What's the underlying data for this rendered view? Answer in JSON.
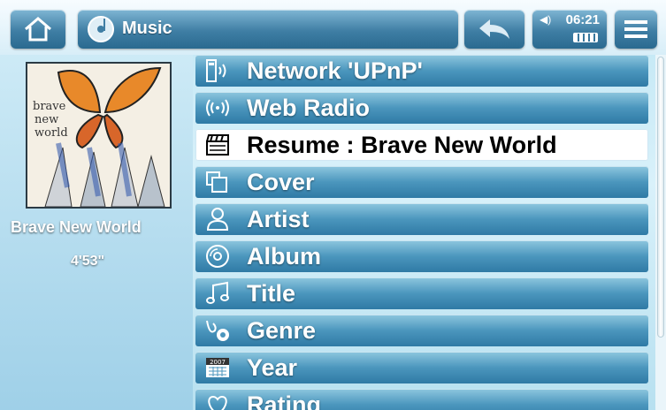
{
  "header": {
    "title": "Music",
    "time": "06:21",
    "icons": [
      "home-icon",
      "music-disc-icon",
      "back-arrow-icon",
      "volume-icon",
      "battery-icon",
      "menu-icon"
    ]
  },
  "now_playing": {
    "track": "Brave New World",
    "duration": "4'53\"",
    "cover_text": [
      "brave",
      "new",
      "world"
    ]
  },
  "menu_items": [
    {
      "label": "Network 'UPnP'",
      "icon": "network-device-icon"
    },
    {
      "label": "Web Radio",
      "icon": "radio-waves-icon"
    },
    {
      "label": "Resume : Brave New World",
      "icon": "clapperboard-icon",
      "selected": true
    },
    {
      "label": "Cover",
      "icon": "covers-icon"
    },
    {
      "label": "Artist",
      "icon": "person-icon"
    },
    {
      "label": "Album",
      "icon": "disc-icon"
    },
    {
      "label": "Title",
      "icon": "music-note-icon"
    },
    {
      "label": "Genre",
      "icon": "genre-icon"
    },
    {
      "label": "Year",
      "icon": "calendar-icon",
      "icon_text": "2007"
    },
    {
      "label": "Rating",
      "icon": "heart-icon"
    }
  ],
  "colors": {
    "row": "#3f86b0",
    "selected_row": "#ffffff",
    "text": "#ffffff"
  }
}
